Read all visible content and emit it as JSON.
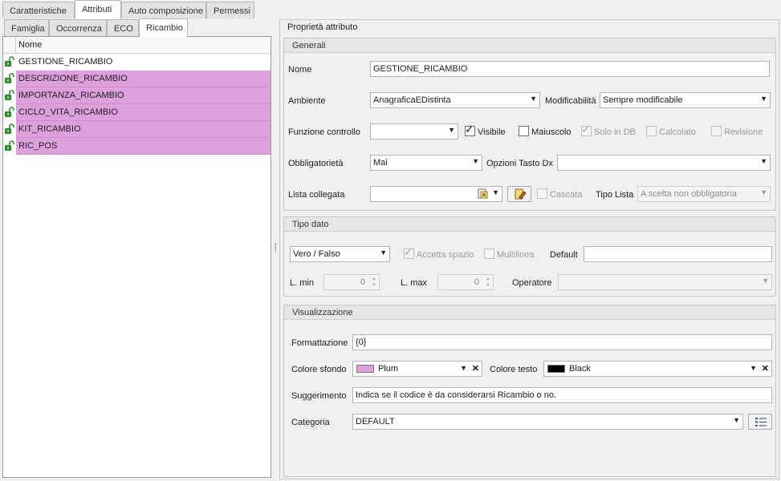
{
  "top_tabs": [
    "Caratteristiche",
    "Attributi",
    "Auto composizione",
    "Permessi"
  ],
  "sub_tabs": [
    "Famiglia",
    "Occorrenza",
    "ECO",
    "Ricambio"
  ],
  "grid": {
    "column": "Nome",
    "rows": [
      "GESTIONE_RICAMBIO",
      "DESCRIZIONE_RICAMBIO",
      "IMPORTANZA_RICAMBIO",
      "CICLO_VITA_RICAMBIO",
      "KIT_RICAMBIO",
      "RIC_POS"
    ],
    "highlight_color": "#dda0dd",
    "lock_color": "#2e8b2e"
  },
  "props": {
    "title": "Proprietà attributo",
    "generali": {
      "header": "Generali",
      "nome_label": "Nome",
      "nome_value": "GESTIONE_RICAMBIO",
      "ambiente_label": "Ambiente",
      "ambiente_value": "AnagraficaEDistinta",
      "modificabilita_label": "Modificabilità",
      "modificabilita_value": "Sempre modificabile",
      "funzione_label": "Funzione controllo",
      "funzione_value": "",
      "visibile": "Visibile",
      "maiuscolo": "Maiuscolo",
      "solo_db": "Solo in DB",
      "calcolato": "Calcolato",
      "revisione": "Revisione",
      "obbligatorieta_label": "Obbligatorietà",
      "obbligatorieta_value": "Mai",
      "opzioni_label": "Opzioni Tasto Dx",
      "opzioni_value": "",
      "lista_label": "Lista collegata",
      "lista_value": "",
      "cascata": "Cascata",
      "tipo_lista_label": "Tipo Lista",
      "tipo_lista_value": "A scelta non obbligatoria"
    },
    "tipo_dato": {
      "header": "Tipo dato",
      "type_value": "Vero / Falso",
      "accetta_spazio": "Accetta spazio",
      "multilinea": "Multilinea",
      "default_label": "Default",
      "default_value": "",
      "lmin_label": "L. min",
      "lmin_value": "0",
      "lmax_label": "L. max",
      "lmax_value": "0",
      "operatore_label": "Operatore",
      "operatore_value": ""
    },
    "visualizzazione": {
      "header": "Visualizzazione",
      "formattazione_label": "Formattazione",
      "formattazione_value": "{0}",
      "colore_sfondo_label": "Colore sfondo",
      "colore_sfondo_value": "Plum",
      "colore_sfondo_hex": "#dda0dd",
      "colore_testo_label": "Colore testo",
      "colore_testo_value": "Black",
      "colore_testo_hex": "#000000",
      "suggerimento_label": "Suggerimento",
      "suggerimento_value": "Indica se il codice è da considerarsi Ricambio o no.",
      "categoria_label": "Categoria",
      "categoria_value": "DEFAULT"
    }
  }
}
